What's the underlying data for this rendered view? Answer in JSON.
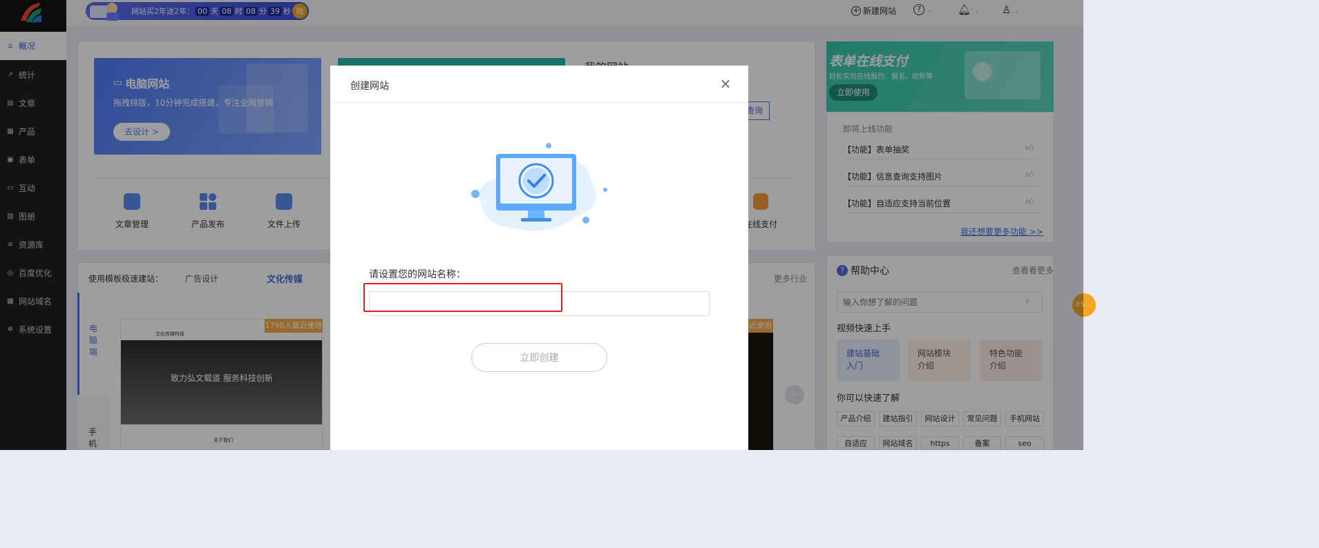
{
  "sidebar": {
    "items": [
      {
        "label": "概况",
        "icon": "home-icon",
        "active": true
      },
      {
        "label": "统计",
        "icon": "stats-icon"
      },
      {
        "label": "文章",
        "icon": "article-icon"
      },
      {
        "label": "产品",
        "icon": "product-icon"
      },
      {
        "label": "表单",
        "icon": "form-icon"
      },
      {
        "label": "互动",
        "icon": "chat-icon"
      },
      {
        "label": "图册",
        "icon": "album-icon"
      },
      {
        "label": "资源库",
        "icon": "database-icon"
      },
      {
        "label": "百度优化",
        "icon": "seo-icon"
      },
      {
        "label": "网站域名",
        "icon": "domain-icon"
      },
      {
        "label": "系统设置",
        "icon": "gear-icon"
      }
    ]
  },
  "topbar": {
    "promo": {
      "text": "网站买2年送2年：",
      "d": "00",
      "d_unit": "天",
      "h": "08",
      "h_unit": "时",
      "m": "08",
      "m_unit": "分",
      "s": "39",
      "s_unit": "秒",
      "grab": "抢"
    },
    "new_site": "新建网站"
  },
  "pc_card": {
    "title": "电脑网站",
    "desc": "拖拽排版，10分钟完成搭建，专注全网营销",
    "button": "去设计 >"
  },
  "my_site": {
    "title": "我的网站",
    "query": "查询"
  },
  "quick_tools": [
    {
      "label": "文章管理"
    },
    {
      "label": "产品发布"
    },
    {
      "label": "文件上传"
    },
    {
      "label": "在线支付"
    }
  ],
  "templates": {
    "prefix": "使用模板极速建站：",
    "cat1": "广告设计",
    "cat2": "文化传媒",
    "more": "更多行业",
    "tab_pc": [
      "电",
      "脑",
      "端"
    ],
    "tab_mobile": [
      "手",
      "机"
    ],
    "badge": "1790人最近使用",
    "badge2": "近使用",
    "thumb_site": "文化传媒科技",
    "thumb_slogan": "致力弘文载道  服务科技创新",
    "thumb_about": "关于我们"
  },
  "banner": {
    "title": "表单在线支付",
    "sub": "轻松实现在线报约、报名、收款等",
    "button": "立即使用"
  },
  "upcoming": {
    "title": "即将上线功能",
    "items": [
      "【功能】表单抽奖",
      "【功能】信息查询支持图片",
      "【功能】自适应支持当前位置"
    ],
    "link": "我还想要更多功能 >>"
  },
  "help": {
    "title": "帮助中心",
    "more": "查看看更多",
    "search_placeholder": "输入你想了解的问题",
    "video_title": "视频快速上手",
    "videos": [
      {
        "line1": "建站基础",
        "line2": "入门"
      },
      {
        "line1": "网站模块",
        "line2": "介绍"
      },
      {
        "line1": "特色功能",
        "line2": "介绍"
      }
    ],
    "quick_title": "你可以快速了解",
    "tags": [
      "产品介绍",
      "建站指引",
      "网站设计",
      "常见问题",
      "手机网站",
      "自适应",
      "网站域名",
      "https",
      "备案",
      "seo"
    ]
  },
  "float_badge": "85",
  "modal": {
    "title": "创建网站",
    "label": "请设置您的网站名称：",
    "input_value": "",
    "button": "立即创建"
  }
}
